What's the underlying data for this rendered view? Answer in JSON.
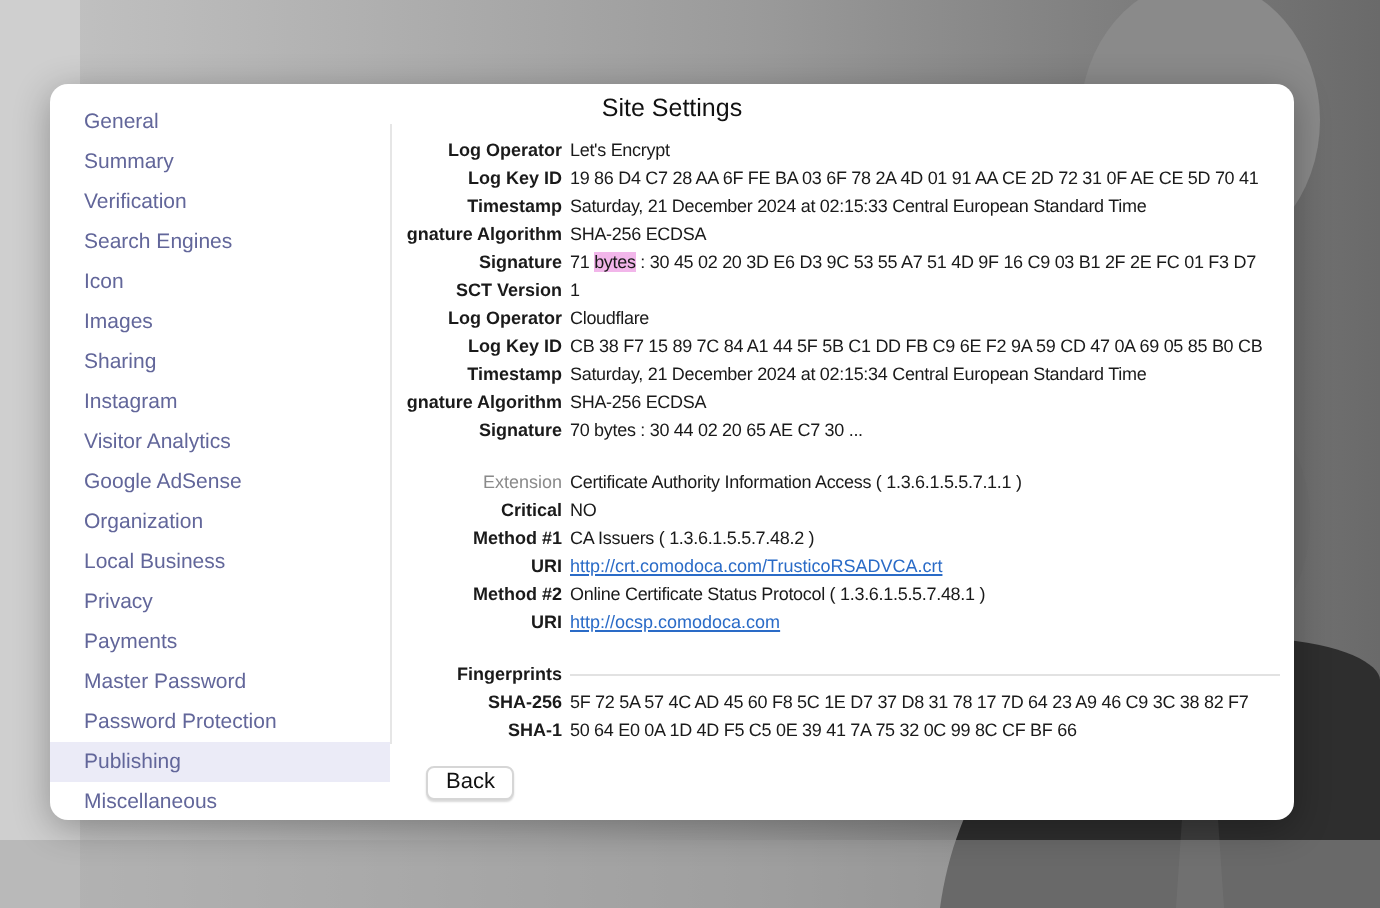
{
  "dialog": {
    "title": "Site Settings",
    "sidebar": {
      "items": [
        {
          "label": "General",
          "selected": false
        },
        {
          "label": "Summary",
          "selected": false
        },
        {
          "label": "Verification",
          "selected": false
        },
        {
          "label": "Search Engines",
          "selected": false
        },
        {
          "label": "Icon",
          "selected": false
        },
        {
          "label": "Images",
          "selected": false
        },
        {
          "label": "Sharing",
          "selected": false
        },
        {
          "label": "Instagram",
          "selected": false
        },
        {
          "label": "Visitor Analytics",
          "selected": false
        },
        {
          "label": "Google AdSense",
          "selected": false
        },
        {
          "label": "Organization",
          "selected": false
        },
        {
          "label": "Local Business",
          "selected": false
        },
        {
          "label": "Privacy",
          "selected": false
        },
        {
          "label": "Payments",
          "selected": false
        },
        {
          "label": "Master Password",
          "selected": false
        },
        {
          "label": "Password Protection",
          "selected": false
        },
        {
          "label": "Publishing",
          "selected": true
        },
        {
          "label": "Miscellaneous",
          "selected": false
        }
      ]
    },
    "details": [
      {
        "kind": "field",
        "label": "Log Operator",
        "dimmed": false,
        "value": "Let's Encrypt"
      },
      {
        "kind": "field",
        "label": "Log Key ID",
        "dimmed": false,
        "value": "19 86 D4 C7 28 AA 6F FE BA 03 6F 78 2A 4D 01 91 AA CE 2D 72 31 0F AE CE 5D 70 41"
      },
      {
        "kind": "field",
        "label": "Timestamp",
        "dimmed": false,
        "value": "Saturday, 21 December 2024 at 02:15:33 Central European Standard Time"
      },
      {
        "kind": "field",
        "label": "gnature Algorithm",
        "dimmed": false,
        "value": "SHA-256 ECDSA"
      },
      {
        "kind": "parts",
        "label": "Signature",
        "dimmed": false,
        "parts": [
          {
            "text": "71 ",
            "highlighted": false
          },
          {
            "text": "bytes",
            "highlighted": true
          },
          {
            "text": " : 30 45 02 20 3D E6 D3 9C 53 55 A7 51 4D 9F 16 C9 03 B1 2F 2E FC 01 F3 D7",
            "highlighted": false
          }
        ]
      },
      {
        "kind": "field",
        "label": "SCT Version",
        "dimmed": false,
        "value": "1"
      },
      {
        "kind": "field",
        "label": "Log Operator",
        "dimmed": false,
        "value": "Cloudflare"
      },
      {
        "kind": "field",
        "label": "Log Key ID",
        "dimmed": false,
        "value": "CB 38 F7 15 89 7C 84 A1 44 5F 5B C1 DD FB C9 6E F2 9A 59 CD 47 0A 69 05 85 B0 CB"
      },
      {
        "kind": "field",
        "label": "Timestamp",
        "dimmed": false,
        "value": "Saturday, 21 December 2024 at 02:15:34 Central European Standard Time"
      },
      {
        "kind": "field",
        "label": "gnature Algorithm",
        "dimmed": false,
        "value": "SHA-256 ECDSA"
      },
      {
        "kind": "field",
        "label": "Signature",
        "dimmed": false,
        "value": "70 bytes : 30 44 02 20 65 AE C7 30 ..."
      },
      {
        "kind": "gap"
      },
      {
        "kind": "field",
        "label": "Extension",
        "dimmed": true,
        "value": "Certificate Authority Information Access ( 1.3.6.1.5.5.7.1.1 )"
      },
      {
        "kind": "field",
        "label": "Critical",
        "dimmed": false,
        "value": "NO"
      },
      {
        "kind": "field",
        "label": "Method #1",
        "dimmed": false,
        "value": "CA Issuers ( 1.3.6.1.5.5.7.48.2 )"
      },
      {
        "kind": "link",
        "label": "URI",
        "dimmed": false,
        "value": "http://crt.comodoca.com/TrusticoRSADVCA.crt"
      },
      {
        "kind": "field",
        "label": "Method #2",
        "dimmed": false,
        "value": "Online Certificate Status Protocol ( 1.3.6.1.5.5.7.48.1 )"
      },
      {
        "kind": "link",
        "label": "URI",
        "dimmed": false,
        "value": "http://ocsp.comodoca.com"
      },
      {
        "kind": "gap"
      },
      {
        "kind": "heading",
        "label": "Fingerprints"
      },
      {
        "kind": "field",
        "label": "SHA-256",
        "dimmed": false,
        "value": "5F 72 5A 57 4C AD 45 60 F8 5C 1E D7 37 D8 31 78 17 7D 64 23 A9 46 C9 3C 38 82 F7"
      },
      {
        "kind": "field",
        "label": "SHA-1",
        "dimmed": false,
        "value": "50 64 E0 0A 1D 4D F5 C5 0E 39 41 7A 75 32 0C 99 8C CF BF 66"
      }
    ],
    "buttons": [
      "Back"
    ]
  }
}
